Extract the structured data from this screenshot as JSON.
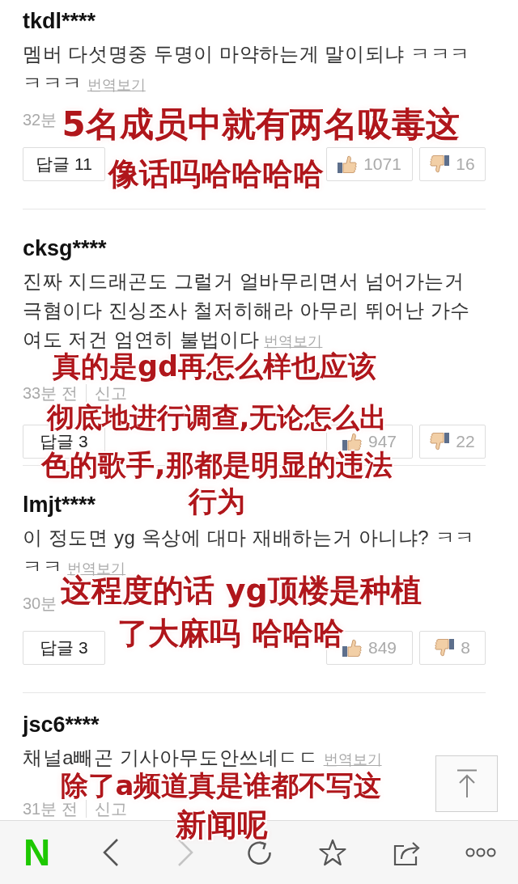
{
  "comments": [
    {
      "username": "tkdl****",
      "text": "멤버 다섯명중 두명이 마약하는게 말이되냐 ㅋㅋㅋㅋㅋㅋ",
      "translate_link": "번역보기",
      "time": "32분",
      "reply_button": "답글 11",
      "likes": "1071",
      "dislikes": "16"
    },
    {
      "username": "cksg****",
      "text": "진짜 지드래곤도 그럴거 얼바무리면서 넘어가는거 극혐이다 진싱조사 철저히해라 아무리 뛰어난 가수여도 저건 엄연히 불법이다",
      "translate_link": "번역보기",
      "time": "33분 전",
      "report": "신고",
      "reply_button": "답글 3",
      "likes": "947",
      "dislikes": "22"
    },
    {
      "username": "lmjt****",
      "text": "이 정도면 yg 옥상에 대마 재배하는거 아니냐? ㅋㅋㅋㅋ",
      "translate_link": "번역보기",
      "time": "30분",
      "reply_button": "답글 3",
      "likes": "849",
      "dislikes": "8"
    },
    {
      "username": "jsc6****",
      "text": "채널a빼곤 기사아무도안쓰네ㄷㄷ",
      "translate_link": "번역보기",
      "time": "31분 전",
      "report": "신고"
    }
  ],
  "captions": [
    {
      "lines": [
        "5名成员中就有两名吸毒这",
        "像话吗哈哈哈哈"
      ]
    },
    {
      "lines": [
        "真的是gd再怎么样也应该",
        "彻底地进行调查,无论怎么出",
        "色的歌手,那都是明显的违法",
        "行为"
      ]
    },
    {
      "lines": [
        "这程度的话 yg顶楼是种植",
        "了大麻吗 哈哈哈"
      ]
    },
    {
      "lines": [
        "除了a频道真是谁都不写这",
        "新闻呢"
      ]
    }
  ],
  "toolbar": {
    "logo": "N",
    "buttons": [
      {
        "kind": "back",
        "disabled": false
      },
      {
        "kind": "forward",
        "disabled": true
      },
      {
        "kind": "refresh",
        "disabled": false
      },
      {
        "kind": "bookmark",
        "disabled": false
      },
      {
        "kind": "share",
        "disabled": false
      },
      {
        "kind": "more",
        "disabled": false
      }
    ]
  }
}
